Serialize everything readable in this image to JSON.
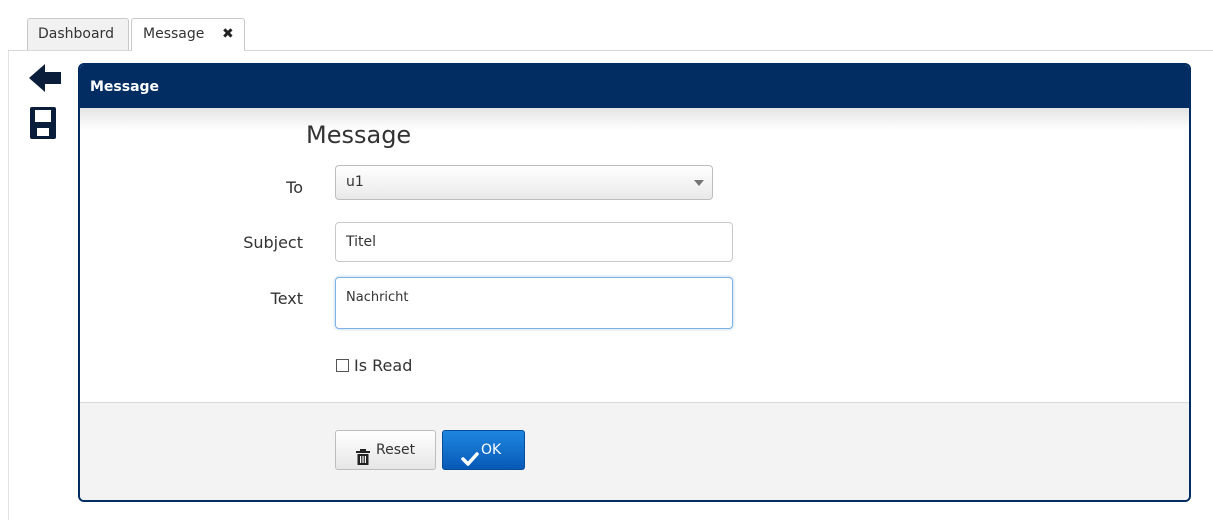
{
  "tabs": {
    "dashboard": "Dashboard",
    "message": "Message"
  },
  "panel": {
    "header": "Message",
    "form_title": "Message"
  },
  "form": {
    "to_label": "To",
    "to_value": "u1",
    "subject_label": "Subject",
    "subject_value": "Titel",
    "text_label": "Text",
    "text_value": "Nachricht",
    "is_read_label": "Is Read",
    "is_read_checked": false
  },
  "buttons": {
    "reset": "Reset",
    "ok": "OK"
  },
  "colors": {
    "header": "#012d62",
    "primary": "#0a66c8"
  },
  "icons": [
    "back-arrow-icon",
    "save-icon",
    "close-icon",
    "trash-icon",
    "checkmark-icon",
    "chevron-down-icon"
  ]
}
